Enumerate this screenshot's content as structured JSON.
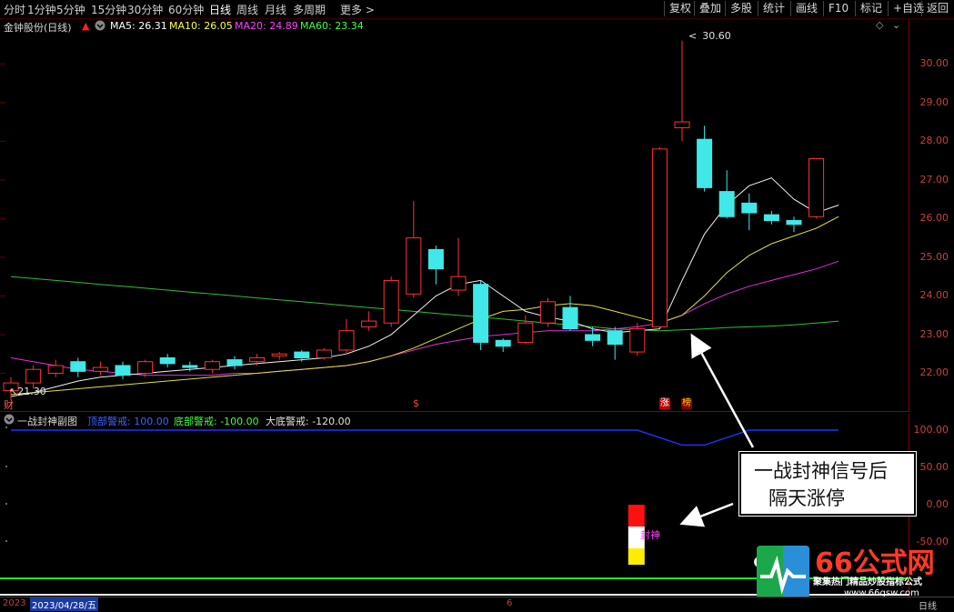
{
  "toolbar": {
    "timeframes": [
      "分时",
      "1分钟",
      "5分钟",
      "15分钟",
      "30分钟",
      "60分钟",
      "日线",
      "周线",
      "月线",
      "多周期",
      "更多 >"
    ],
    "active_timeframe": "日线",
    "right_buttons": [
      "复权",
      "叠加",
      "多股",
      "统计",
      "画线",
      "F10",
      "标记",
      "+自选",
      "返回"
    ]
  },
  "stock": {
    "name": "金钟股份(日线)",
    "ma5": "MA5: 26.31",
    "ma10": "MA10: 26.05",
    "ma20": "MA20: 24.89",
    "ma60": "MA60: 23.34"
  },
  "main_axis_labels": [
    "30.00",
    "29.00",
    "28.00",
    "27.00",
    "26.00",
    "25.00",
    "24.00",
    "23.00",
    "22.00"
  ],
  "main_marks": {
    "high_label": "30.60",
    "low_label": "21.30",
    "finance_tag": "财",
    "dollar_tag": "$",
    "zt_tag": "涨",
    "bang_tag": "榜"
  },
  "indicator": {
    "name": "一战封神副图",
    "top_warn": "顶部警戒: 100.00",
    "bottom_warn": "底部警戒: -100.00",
    "big_bottom_warn": "大底警戒: -120.00",
    "axis_labels": [
      "100.00",
      "50.00",
      "0.00",
      "-50.00"
    ],
    "signal_label": "封神"
  },
  "annotation": {
    "line1": "一战封神信号后",
    "line2": "隔天涨停"
  },
  "bottom": {
    "year": "2023",
    "date": "2023/04/28/五",
    "mark": "6",
    "period": "日线"
  },
  "watermark": {
    "brand": "66公式网",
    "slogan": "聚集热门精品炒股指标公式",
    "url": "www.66gsw.com"
  },
  "chart_data": {
    "type": "candlestick",
    "ylim": [
      21.0,
      30.9
    ],
    "candles": [
      {
        "o": 21.55,
        "c": 21.75,
        "h": 21.9,
        "l": 21.3
      },
      {
        "o": 21.75,
        "c": 22.1,
        "h": 22.2,
        "l": 21.6
      },
      {
        "o": 22.0,
        "c": 22.2,
        "h": 22.35,
        "l": 21.9
      },
      {
        "o": 22.3,
        "c": 22.05,
        "h": 22.4,
        "l": 21.9
      },
      {
        "o": 22.05,
        "c": 22.15,
        "h": 22.3,
        "l": 21.95
      },
      {
        "o": 22.2,
        "c": 21.95,
        "h": 22.3,
        "l": 21.85
      },
      {
        "o": 22.0,
        "c": 22.3,
        "h": 22.35,
        "l": 21.9
      },
      {
        "o": 22.4,
        "c": 22.25,
        "h": 22.5,
        "l": 22.15
      },
      {
        "o": 22.2,
        "c": 22.15,
        "h": 22.3,
        "l": 22.05
      },
      {
        "o": 22.1,
        "c": 22.3,
        "h": 22.35,
        "l": 22.0
      },
      {
        "o": 22.35,
        "c": 22.2,
        "h": 22.45,
        "l": 22.1
      },
      {
        "o": 22.3,
        "c": 22.4,
        "h": 22.5,
        "l": 22.2
      },
      {
        "o": 22.45,
        "c": 22.5,
        "h": 22.55,
        "l": 22.35
      },
      {
        "o": 22.55,
        "c": 22.4,
        "h": 22.6,
        "l": 22.3
      },
      {
        "o": 22.4,
        "c": 22.6,
        "h": 22.65,
        "l": 22.35
      },
      {
        "o": 22.6,
        "c": 23.1,
        "h": 23.4,
        "l": 22.5
      },
      {
        "o": 23.2,
        "c": 23.35,
        "h": 23.6,
        "l": 23.1
      },
      {
        "o": 23.3,
        "c": 24.4,
        "h": 24.5,
        "l": 23.2
      },
      {
        "o": 24.05,
        "c": 25.5,
        "h": 26.45,
        "l": 23.95
      },
      {
        "o": 25.2,
        "c": 24.7,
        "h": 25.3,
        "l": 24.3
      },
      {
        "o": 24.15,
        "c": 24.5,
        "h": 25.5,
        "l": 24.0
      },
      {
        "o": 24.3,
        "c": 22.8,
        "h": 24.4,
        "l": 22.6
      },
      {
        "o": 22.85,
        "c": 22.7,
        "h": 22.9,
        "l": 22.55
      },
      {
        "o": 22.8,
        "c": 23.3,
        "h": 23.5,
        "l": 22.75
      },
      {
        "o": 23.3,
        "c": 23.85,
        "h": 23.95,
        "l": 23.2
      },
      {
        "o": 23.7,
        "c": 23.15,
        "h": 24.0,
        "l": 23.1
      },
      {
        "o": 23.0,
        "c": 22.85,
        "h": 23.2,
        "l": 22.7
      },
      {
        "o": 23.1,
        "c": 22.75,
        "h": 23.2,
        "l": 22.35
      },
      {
        "o": 22.55,
        "c": 23.15,
        "h": 23.3,
        "l": 22.45
      },
      {
        "o": 23.2,
        "c": 27.8,
        "h": 27.85,
        "l": 23.2
      },
      {
        "o": 28.35,
        "c": 28.5,
        "h": 30.6,
        "l": 28.0
      },
      {
        "o": 28.05,
        "c": 26.8,
        "h": 28.4,
        "l": 26.7
      },
      {
        "o": 26.7,
        "c": 26.05,
        "h": 27.25,
        "l": 26.0
      },
      {
        "o": 26.4,
        "c": 26.15,
        "h": 26.65,
        "l": 25.7
      },
      {
        "o": 26.1,
        "c": 25.95,
        "h": 26.2,
        "l": 25.85
      },
      {
        "o": 25.95,
        "c": 25.85,
        "h": 26.05,
        "l": 25.65
      },
      {
        "o": 26.05,
        "c": 27.55,
        "h": 27.55,
        "l": 26.0
      }
    ],
    "ma5": [
      21.4,
      21.5,
      21.65,
      21.8,
      21.9,
      21.95,
      22.0,
      22.05,
      22.1,
      22.15,
      22.2,
      22.25,
      22.3,
      22.35,
      22.4,
      22.5,
      22.7,
      23.0,
      23.5,
      24.0,
      24.3,
      24.4,
      24.0,
      23.6,
      23.45,
      23.35,
      23.15,
      23.05,
      23.1,
      23.15,
      24.4,
      25.6,
      26.35,
      26.85,
      27.05,
      26.5,
      26.15,
      26.35
    ],
    "ma10": [
      21.45,
      21.5,
      21.55,
      21.6,
      21.65,
      21.7,
      21.75,
      21.8,
      21.85,
      21.9,
      21.95,
      22.0,
      22.05,
      22.1,
      22.15,
      22.2,
      22.3,
      22.45,
      22.65,
      22.9,
      23.15,
      23.4,
      23.6,
      23.65,
      23.75,
      23.8,
      23.75,
      23.6,
      23.45,
      23.3,
      23.5,
      24.0,
      24.6,
      25.05,
      25.35,
      25.55,
      25.75,
      26.05
    ],
    "ma20": [
      22.4,
      22.3,
      22.2,
      22.1,
      22.05,
      22.0,
      21.95,
      21.95,
      21.95,
      21.95,
      22.0,
      22.0,
      22.05,
      22.1,
      22.15,
      22.2,
      22.3,
      22.45,
      22.6,
      22.75,
      22.85,
      22.95,
      23.0,
      23.05,
      23.1,
      23.1,
      23.1,
      23.15,
      23.2,
      23.3,
      23.5,
      23.8,
      24.05,
      24.25,
      24.4,
      24.55,
      24.7,
      24.9
    ],
    "ma60": [
      24.5,
      24.45,
      24.4,
      24.35,
      24.3,
      24.25,
      24.2,
      24.15,
      24.1,
      24.05,
      24.0,
      23.95,
      23.9,
      23.85,
      23.8,
      23.75,
      23.7,
      23.65,
      23.6,
      23.55,
      23.5,
      23.45,
      23.4,
      23.35,
      23.3,
      23.25,
      23.2,
      23.15,
      23.12,
      23.1,
      23.12,
      23.15,
      23.18,
      23.2,
      23.22,
      23.25,
      23.3,
      23.35
    ],
    "indicator_line": [
      100,
      100,
      100,
      100,
      100,
      100,
      100,
      100,
      100,
      100,
      100,
      100,
      100,
      100,
      100,
      100,
      100,
      100,
      100,
      100,
      100,
      100,
      100,
      100,
      100,
      100,
      100,
      100,
      100,
      90,
      80,
      80,
      90,
      100,
      100,
      100,
      100,
      100
    ],
    "signal_index": 28
  }
}
